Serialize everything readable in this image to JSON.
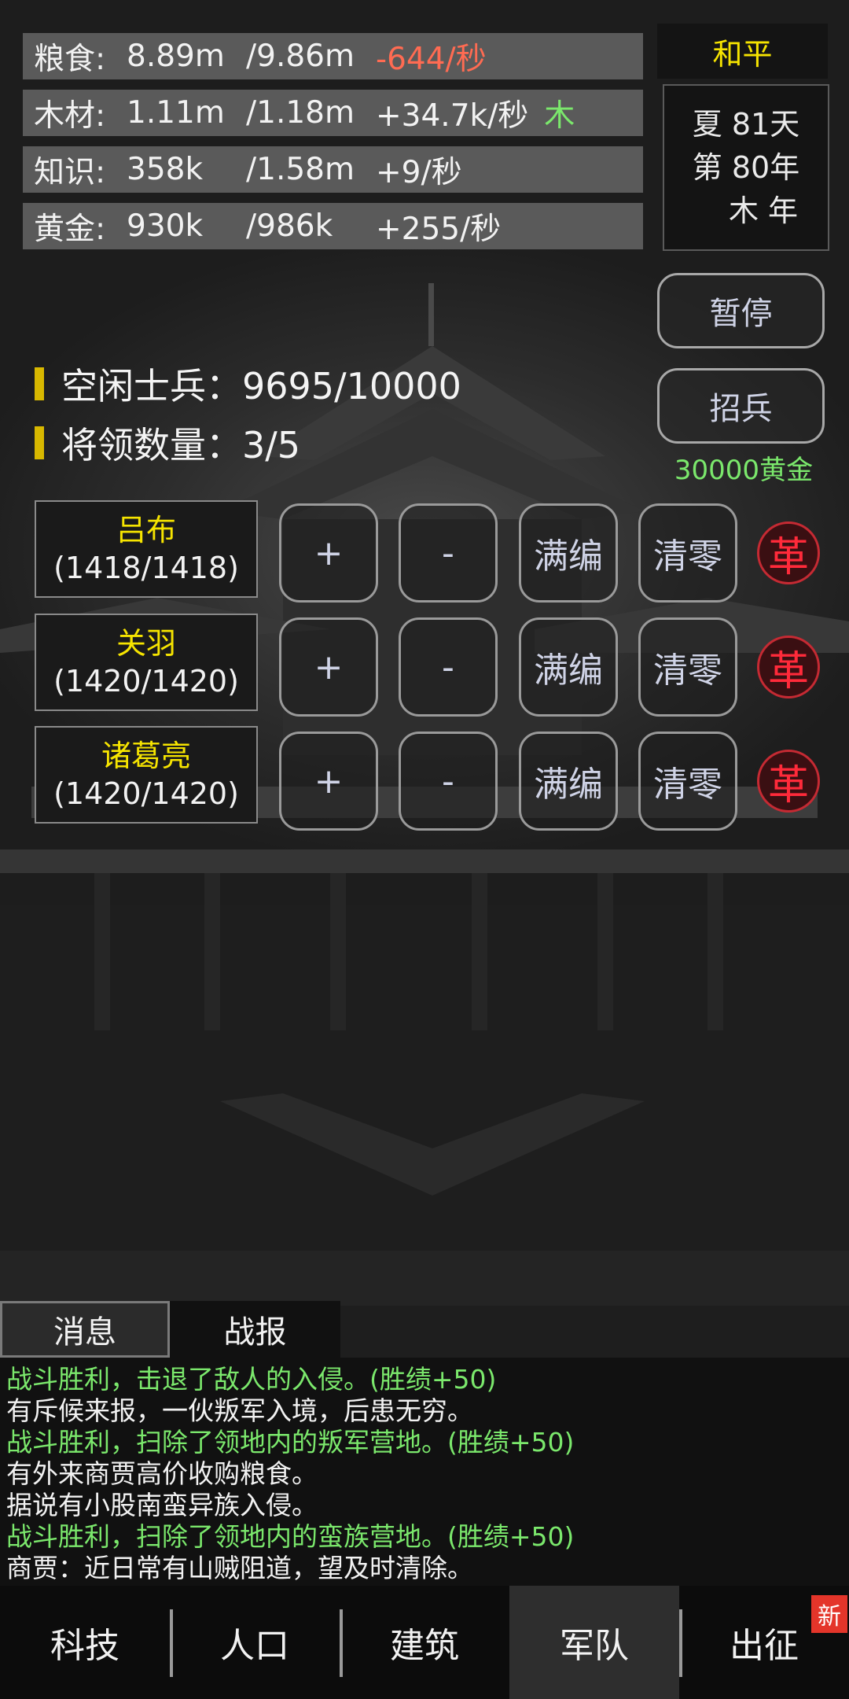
{
  "resources": [
    {
      "name": "粮食:",
      "current": "8.89m",
      "max": "/9.86m",
      "rate": "-644/秒",
      "tag": ""
    },
    {
      "name": "木材:",
      "current": "1.11m",
      "max": "/1.18m",
      "rate": "+34.7k/秒",
      "tag": "木"
    },
    {
      "name": "知识:",
      "current": "358k",
      "max": "/1.58m",
      "rate": "+9/秒",
      "tag": ""
    },
    {
      "name": "黄金:",
      "current": "930k",
      "max": "/986k",
      "rate": "+255/秒",
      "tag": ""
    }
  ],
  "status": "和平",
  "date": {
    "line1": "夏 81天",
    "line2": "第 80年",
    "line3": "木 年"
  },
  "buttons": {
    "pause": "暂停",
    "recruit": "招兵",
    "recruit_cost": "30000黄金"
  },
  "army": {
    "idle_label": "空闲士兵：9695/10000",
    "general_label": "将领数量：3/5"
  },
  "generals": [
    {
      "name": "吕布",
      "troops": "(1418/1418)"
    },
    {
      "name": "关羽",
      "troops": "(1420/1420)"
    },
    {
      "name": "诸葛亮",
      "troops": "(1420/1420)"
    }
  ],
  "general_actions": {
    "add": "+",
    "remove": "-",
    "fill": "满编",
    "clear": "清零",
    "dismiss": "革"
  },
  "tabs": {
    "messages": "消息",
    "battle": "战报"
  },
  "log": [
    {
      "text": "战斗胜利，击退了敌人的入侵。(胜绩+50)",
      "kind": "win"
    },
    {
      "text": "有斥候来报，一伙叛军入境，后患无穷。",
      "kind": "info"
    },
    {
      "text": "战斗胜利，扫除了领地内的叛军营地。(胜绩+50)",
      "kind": "win"
    },
    {
      "text": "有外来商贾高价收购粮食。",
      "kind": "info"
    },
    {
      "text": "据说有小股南蛮异族入侵。",
      "kind": "info"
    },
    {
      "text": "战斗胜利，扫除了领地内的蛮族营地。(胜绩+50)",
      "kind": "win"
    },
    {
      "text": "商贾：近日常有山贼阻道，望及时清除。",
      "kind": "info"
    }
  ],
  "nav": [
    {
      "label": "科技",
      "active": false
    },
    {
      "label": "人口",
      "active": false
    },
    {
      "label": "建筑",
      "active": false
    },
    {
      "label": "军队",
      "active": true
    },
    {
      "label": "出征",
      "active": false,
      "badge": "新"
    }
  ],
  "colors": {
    "highlight_yellow": "#f6e400",
    "positive_green": "#7be86c",
    "negative_red": "#ff6b52",
    "dismiss_red": "#ff2a3a"
  }
}
